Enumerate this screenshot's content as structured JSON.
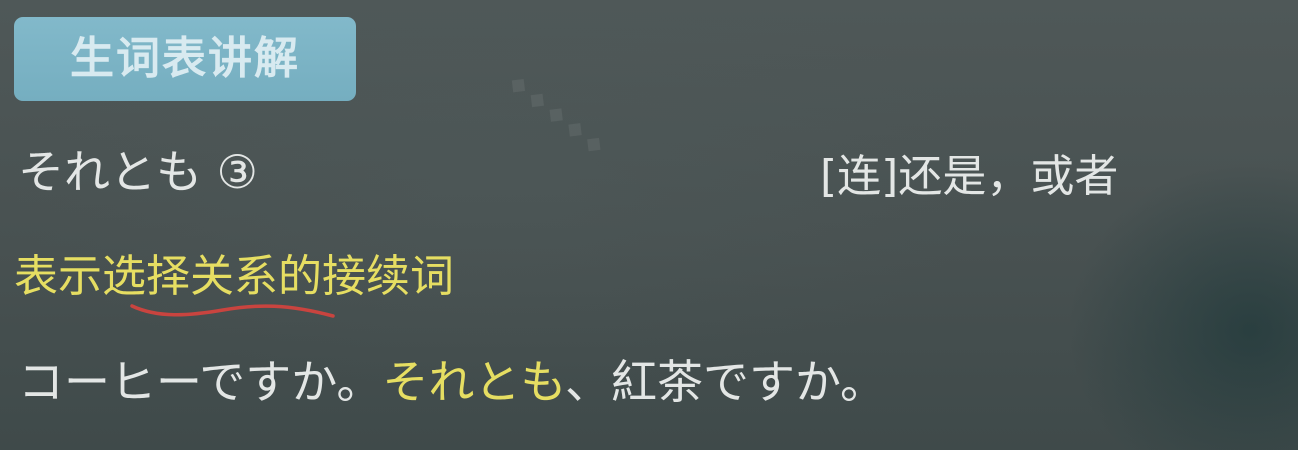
{
  "title": "生词表讲解",
  "word": "それとも ③",
  "meaning": "[连]还是，或者",
  "explanation": {
    "before": "表示",
    "marked": "选择关系",
    "after": "的接续词"
  },
  "example": {
    "part1": "コーヒーですか。",
    "highlight": "それとも",
    "part2": "、紅茶ですか。"
  },
  "colors": {
    "highlight": "#e6de62",
    "underline": "#c9443f",
    "badge": "#7bb3c4"
  }
}
